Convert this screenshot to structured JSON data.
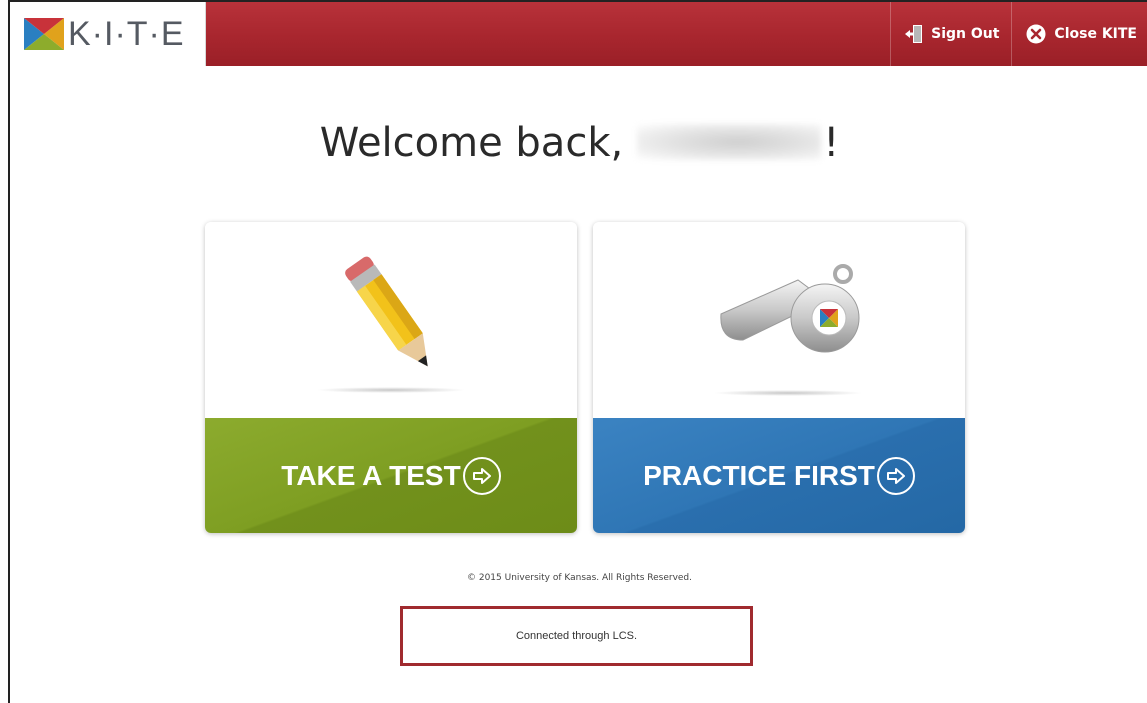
{
  "header": {
    "logo_text": "K·I·T·E",
    "sign_out_label": "Sign Out",
    "close_label": "Close KITE",
    "bar_color": "#a8262e"
  },
  "main": {
    "welcome_prefix": "Welcome back,",
    "welcome_suffix": "!",
    "cards": [
      {
        "label": "TAKE A TEST",
        "color": "#7e9e22",
        "icon": "pencil-icon"
      },
      {
        "label": "PRACTICE FIRST",
        "color": "#2f76b5",
        "icon": "whistle-icon"
      }
    ]
  },
  "footer": {
    "copyright": "© 2015 University of Kansas. All Rights Reserved.",
    "connection_status": "Connected through LCS."
  }
}
